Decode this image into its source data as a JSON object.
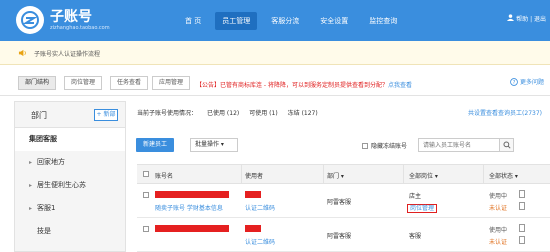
{
  "header": {
    "logo_title": "子账号",
    "logo_sub": "zizhanghao.taobao.com",
    "nav": [
      "首 页",
      "员工管理",
      "客服分流",
      "安全设置",
      "监控查询"
    ],
    "right": "帮助 | 退出",
    "brand_color": "#3a8ede"
  },
  "notice": {
    "text": "子账号实人认证操作流程"
  },
  "tabs": [
    "部门结构",
    "岗位管理",
    "任务查看",
    "应用管理"
  ],
  "tab_notice": {
    "prefix": "【公告】",
    "text": "已管有商标库连 - 将降降，可以到服务定制员提供查看到分配？",
    "link": "点我查看"
  },
  "help": {
    "label": "更多问题"
  },
  "sidebar": {
    "title": "部门",
    "add_label": "+ 新部",
    "items": [
      {
        "label": "集团客服",
        "bold": true,
        "arrow": false
      },
      {
        "label": "回家地方",
        "bold": false,
        "arrow": true
      },
      {
        "label": "居生便利生心苏",
        "bold": false,
        "arrow": true
      },
      {
        "label": "客服1",
        "bold": false,
        "arrow": true
      },
      {
        "label": "技是",
        "bold": false,
        "arrow": false
      }
    ]
  },
  "stats": {
    "label": "当前子账号使用情况：",
    "used": "已使用 (12)",
    "available": "可使用 (1)",
    "expired": "冻结 (127)",
    "link": "共设置查看查询员工(2737)"
  },
  "toolbar": {
    "new_employee": "新建员工",
    "batch_label": "批量操作 ▾",
    "hide_frozen": "隐藏冻结账号",
    "search_placeholder": "请输入员工账号名"
  },
  "table": {
    "headers": [
      "账号名",
      "使用者",
      "部门 ▾",
      "全部岗位 ▾",
      "全部状态 ▾"
    ],
    "rows": [
      {
        "account_sub": "随卖子账号 学财基本信息",
        "user_sub": "认证二维码",
        "dept": "阿雷客服",
        "post": "店主",
        "post_link": "岗位管理",
        "status": "使用中",
        "status_sub": "未认证"
      },
      {
        "account_sub": "",
        "user_sub": "认证二维码",
        "dept": "阿雷客服",
        "post": "客服",
        "post_link": "",
        "status": "使用中",
        "status_sub": "未认证"
      }
    ]
  }
}
